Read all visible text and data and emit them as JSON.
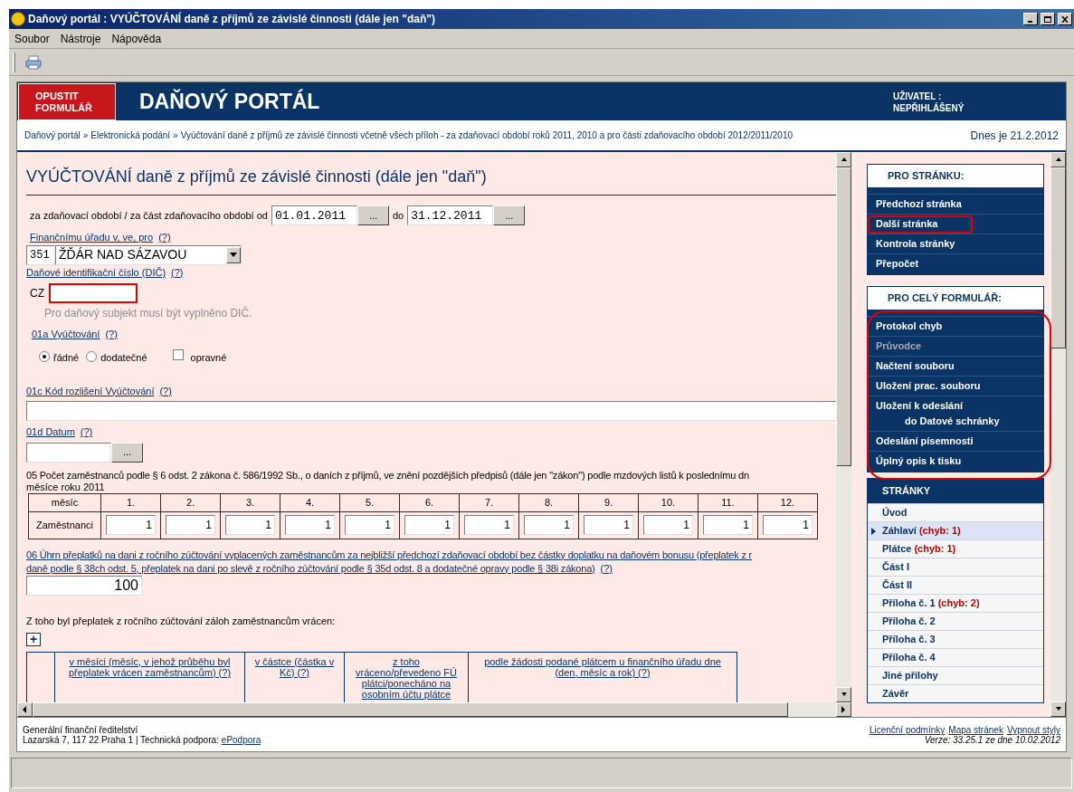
{
  "window": {
    "title": "Daňový portál :  VYÚČTOVÁNÍ daně z příjmů ze závislé činnosti (dále jen \"daň\")"
  },
  "menu": [
    {
      "label": "Soubor"
    },
    {
      "label": "Nástroje"
    },
    {
      "label": "Nápověda"
    }
  ],
  "header": {
    "exit_button": "OPUSTIT FORMULÁŘ",
    "title": "DAŇOVÝ PORTÁL",
    "user_label": "UŽIVATEL :",
    "user_value": "NEPŘIHLÁŠENÝ"
  },
  "breadcrumb": {
    "separator": "»",
    "items": [
      "Daňový portál",
      "Elektronická podání",
      "Vyúčtování daně z příjmů ze závislé činnosti včetně všech příloh - za zdaňovací období roků 2011, 2010 a pro části zdaňovacího období 2012/2011/2010"
    ],
    "date": "Dnes je 21.2.2012"
  },
  "form": {
    "title": "VYÚČTOVÁNÍ daně z příjmů ze závislé činnosti (dále jen \"daň\")",
    "period": {
      "label": "za zdaňovací období / za část zdaňovacího období od",
      "from_value": "01.01.2011",
      "to_label": "do",
      "to_value": "31.12.2011",
      "picker": "..."
    },
    "office": {
      "label": "Finančnímu úřadu v, ve, pro",
      "help": "(?)",
      "code": "351",
      "value": "ŽĎÁR NAD SÁZAVOU"
    },
    "dic": {
      "label": "Daňové identifikační číslo (DIČ)",
      "help": "(?)",
      "prefix": "CZ",
      "error": true,
      "message": "Pro daňový subjekt musí být vyplněno DIČ."
    },
    "vyuctovani": {
      "label": "01a Vyúčtování",
      "help": "(?)",
      "options": [
        {
          "kind": "radio",
          "label": "řádné",
          "selected": true
        },
        {
          "kind": "radio",
          "label": "dodatečné",
          "selected": false
        },
        {
          "kind": "checkbox",
          "label": "opravné",
          "checked": false
        }
      ]
    },
    "kod": {
      "label": "01c Kód rozlišení Vyúčtování",
      "help": "(?)"
    },
    "datum": {
      "label": "01d Datum",
      "help": "(?)",
      "picker": "..."
    },
    "employees": {
      "line_1": "05 Počet zaměstnanců podle § 6 odst. 2 zákona č. 586/1992 Sb., o daních z příjmů, ve znění pozdějších předpisů (dále jen \"zákon\") podle mzdových listů k poslednímu dn",
      "line_2": "měsíce roku 2011",
      "month_header": "měsíc",
      "months": [
        "1.",
        "2.",
        "3.",
        "4.",
        "5.",
        "6.",
        "7.",
        "8.",
        "9.",
        "10.",
        "11.",
        "12."
      ],
      "row_label": "Zaměstnanci",
      "values": [
        "1",
        "1",
        "1",
        "1",
        "1",
        "1",
        "1",
        "1",
        "1",
        "1",
        "1",
        "1"
      ]
    },
    "overpayment": {
      "line_1": "06 Úhrn přeplatků na dani z ročního zúčtování vyplacených zaměstnancům za nejbližší předchozí zdaňovací období bez částky doplatku na daňovém bonusu (přeplatek z r",
      "line_2": "daně podle § 38ch odst. 5, přeplatek na dani po slevě z ročního zúčtování podle § 35d odst. 8 a dodatečné opravy podle § 38i zákona)",
      "help": "(?)",
      "value": "100"
    },
    "returned": {
      "text": "Z toho byl přeplatek z ročního zúčtování záloh zaměstnancům vrácen:",
      "add": "+",
      "columns": [
        {
          "label": "v měsíci (měsíc, v jehož průběhu byl přeplatek vrácen zaměstnancům)",
          "help": "(?)"
        },
        {
          "label": "v částce (částka v Kč)",
          "help": "(?)"
        },
        {
          "label": "z toho vráceno/převedeno FÚ plátci/ponecháno na osobním účtu plátce"
        },
        {
          "label": "podle žádosti podané plátcem u finančního úřadu dne (den, měsíc a rok)",
          "help": "(?)"
        }
      ]
    }
  },
  "sidebar": {
    "page_actions": {
      "title": "PRO STRÁNKU:",
      "items": [
        {
          "label": "Předchozí stránka",
          "highlighted": false
        },
        {
          "label": "Další stránka",
          "highlighted": true
        },
        {
          "label": "Kontrola stránky",
          "highlighted": false
        },
        {
          "label": "Přepočet",
          "highlighted": false
        }
      ]
    },
    "form_actions": {
      "title": "PRO CELÝ FORMULÁŘ:",
      "highlighted": true,
      "items": [
        {
          "lines": [
            "Protokol chyb"
          ],
          "disabled": false
        },
        {
          "lines": [
            "Průvodce"
          ],
          "disabled": true
        },
        {
          "lines": [
            "Načtení souboru"
          ],
          "disabled": false
        },
        {
          "lines": [
            "Uložení prac. souboru"
          ],
          "disabled": false
        },
        {
          "lines": [
            "Uložení k odeslání",
            "do Datové schránky"
          ],
          "disabled": false
        },
        {
          "lines": [
            "Odeslání písemnosti"
          ],
          "disabled": false
        },
        {
          "lines": [
            "Úplný opis k tisku"
          ],
          "disabled": false
        }
      ]
    },
    "pages": {
      "title": "STRÁNKY",
      "items": [
        {
          "label": "Úvod",
          "selected": false
        },
        {
          "label": "Záhlaví",
          "errors": "(chyb: 1)",
          "selected": true
        },
        {
          "label": "Plátce",
          "errors": "(chyb: 1)",
          "selected": false
        },
        {
          "label": "Část I",
          "selected": false
        },
        {
          "label": "Část II",
          "selected": false
        },
        {
          "label": "Příloha č. 1",
          "errors": "(chyb: 2)",
          "selected": false
        },
        {
          "label": "Příloha č. 2",
          "selected": false
        },
        {
          "label": "Příloha č. 3",
          "selected": false
        },
        {
          "label": "Příloha č. 4",
          "selected": false
        },
        {
          "label": "Jiné přílohy",
          "selected": false
        },
        {
          "label": "Závěr",
          "selected": false
        }
      ]
    }
  },
  "footer": {
    "org": "Generální finanční ředitelství",
    "address": "Lazarská 7, 117 22 Praha 1 | Technická podpora:",
    "support_link": "ePodpora",
    "links": [
      "Licenční podmínky",
      "Mapa stránek",
      "Vypnout styly"
    ],
    "version": "Verze: 33.25.1 ze dne 10.02.2012"
  }
}
